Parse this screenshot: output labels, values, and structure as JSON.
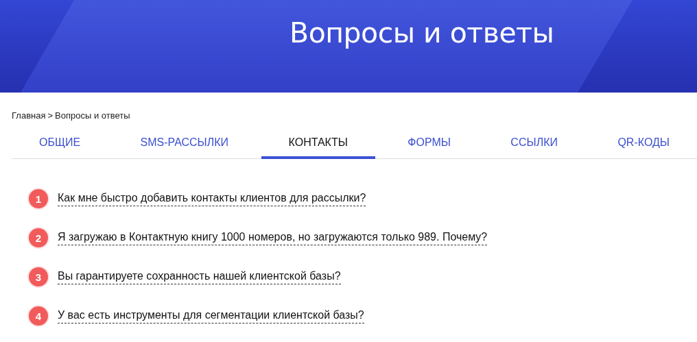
{
  "header": {
    "title": "Вопросы и ответы"
  },
  "breadcrumb": {
    "items": [
      "Главная",
      "Вопросы и ответы"
    ],
    "separator": ">"
  },
  "tabs": [
    {
      "label": "ОБЩИЕ",
      "selected": false
    },
    {
      "label": "SMS-РАССЫЛКИ",
      "selected": false
    },
    {
      "label": "КОНТАКТЫ",
      "selected": true
    },
    {
      "label": "ФОРМЫ",
      "selected": false
    },
    {
      "label": "ССЫЛКИ",
      "selected": false
    },
    {
      "label": "QR-КОДЫ",
      "selected": false
    }
  ],
  "questions": [
    {
      "number": "1",
      "text": "Как мне быстро добавить контакты клиентов для рассылки?"
    },
    {
      "number": "2",
      "text": "Я загружаю в Контактную книгу 1000 номеров, но загружаются только 989. Почему?"
    },
    {
      "number": "3",
      "text": "Вы гарантируете сохранность нашей клиентской базы?"
    },
    {
      "number": "4",
      "text": "У вас есть инструменты для сегментации клиентской базы?"
    }
  ]
}
